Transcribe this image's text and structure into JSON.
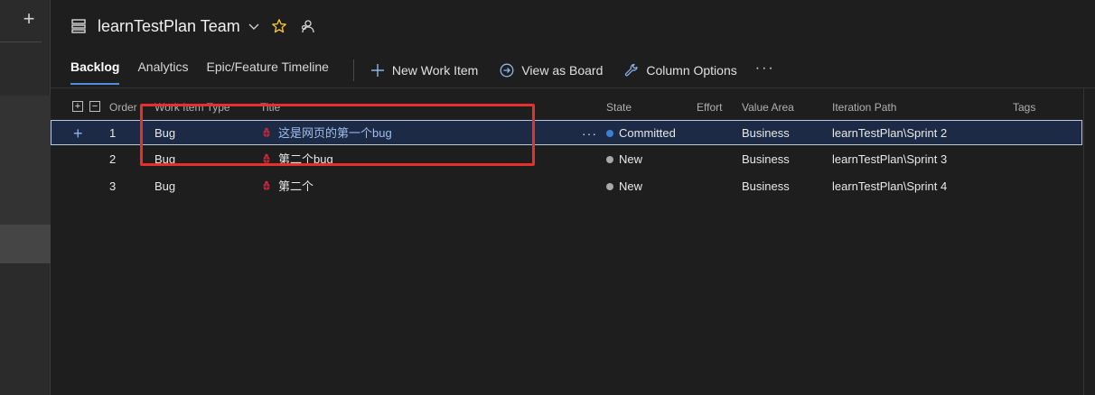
{
  "rail": {
    "add_label": "+"
  },
  "header": {
    "team_name": "learnTestPlan Team"
  },
  "tabs": [
    {
      "label": "Backlog",
      "active": true
    },
    {
      "label": "Analytics",
      "active": false
    },
    {
      "label": "Epic/Feature Timeline",
      "active": false
    }
  ],
  "toolbar": {
    "new_work_item": "New Work Item",
    "view_as_board": "View as Board",
    "column_options": "Column Options",
    "more": "···"
  },
  "grid": {
    "expand_all": "+",
    "collapse_all": "−",
    "columns": {
      "order": "Order",
      "work_item_type": "Work Item Type",
      "title": "Title",
      "state": "State",
      "effort": "Effort",
      "value_area": "Value Area",
      "iteration_path": "Iteration Path",
      "tags": "Tags"
    },
    "rows": [
      {
        "order": "1",
        "type": "Bug",
        "title": "这是网页的第一个bug",
        "state": "Committed",
        "state_color": "#3b7ed6",
        "effort": "",
        "value_area": "Business",
        "iteration_path": "learnTestPlan\\Sprint 2",
        "tags": "",
        "selected": true,
        "row_add": "+",
        "row_more": "···"
      },
      {
        "order": "2",
        "type": "Bug",
        "title": "第二个bug",
        "state": "New",
        "state_color": "#a8a8a8",
        "effort": "",
        "value_area": "Business",
        "iteration_path": "learnTestPlan\\Sprint 3",
        "tags": ""
      },
      {
        "order": "3",
        "type": "Bug",
        "title": "第二个",
        "state": "New",
        "state_color": "#a8a8a8",
        "effort": "",
        "value_area": "Business",
        "iteration_path": "learnTestPlan\\Sprint 4",
        "tags": ""
      }
    ]
  },
  "colors": {
    "accent": "#4d8ee0",
    "bug_icon": "#cc293d",
    "highlight": "#e7302b"
  }
}
